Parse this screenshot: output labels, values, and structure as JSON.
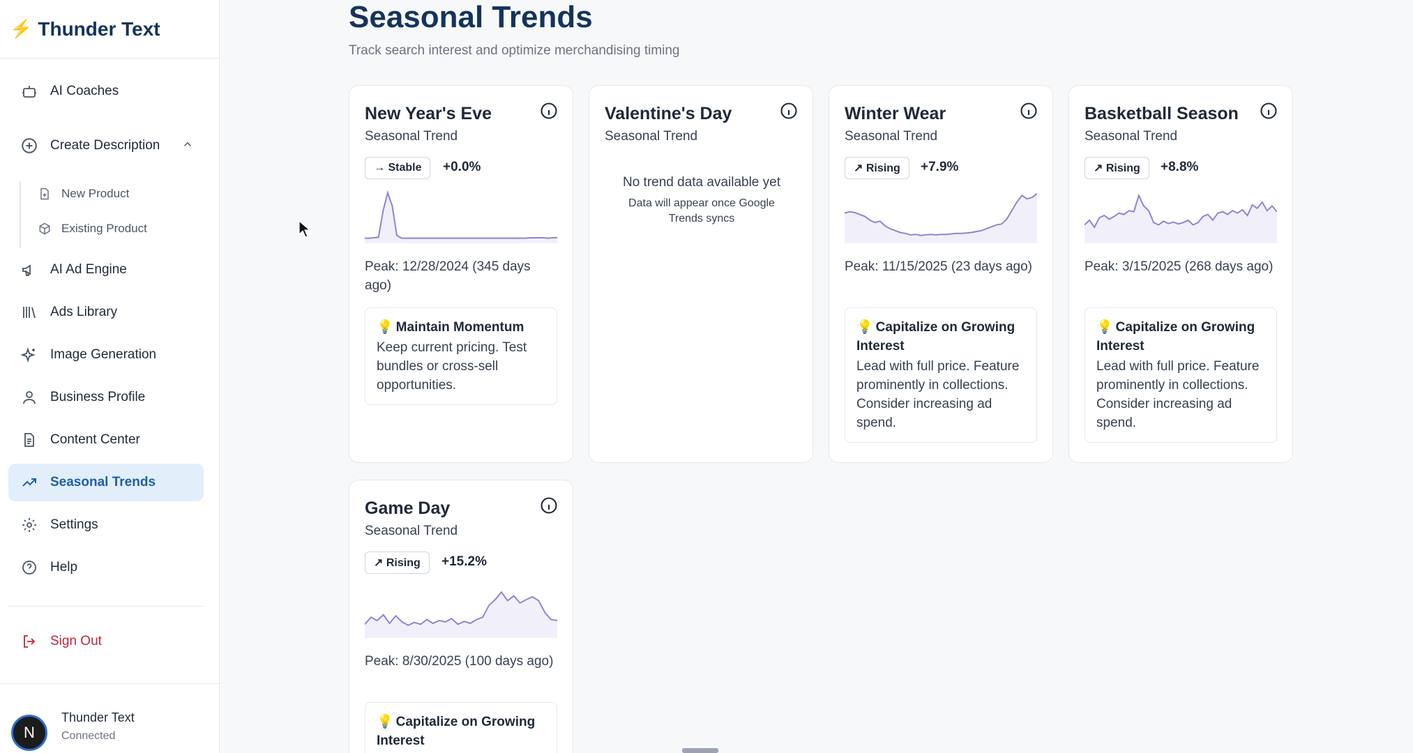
{
  "app": {
    "brand": "Thunder Text"
  },
  "sidebar": {
    "items": [
      {
        "label": "AI Coaches",
        "icon": "robot-icon"
      },
      {
        "label": "Create Description",
        "icon": "plus-circle-icon"
      },
      {
        "label": "AI Ad Engine",
        "icon": "megaphone-icon"
      },
      {
        "label": "Ads Library",
        "icon": "library-icon"
      },
      {
        "label": "Image Generation",
        "icon": "sparkles-icon"
      },
      {
        "label": "Business Profile",
        "icon": "user-icon"
      },
      {
        "label": "Content Center",
        "icon": "document-icon"
      },
      {
        "label": "Seasonal Trends",
        "icon": "trending-up-icon"
      },
      {
        "label": "Settings",
        "icon": "gear-icon"
      },
      {
        "label": "Help",
        "icon": "help-circle-icon"
      }
    ],
    "subitems": [
      {
        "label": "New Product",
        "icon": "file-plus-icon"
      },
      {
        "label": "Existing Product",
        "icon": "box-icon"
      }
    ],
    "signout": "Sign Out",
    "account": {
      "name": "Thunder Text",
      "status": "Connected",
      "initial": "N"
    }
  },
  "page": {
    "title": "Seasonal Trends",
    "subtitle": "Track search interest and optimize merchandising timing"
  },
  "cards": [
    {
      "title": "New Year's Eve",
      "subtitle": "Seasonal Trend",
      "badge": "→ Stable",
      "pct": "+0.0%",
      "peak": "Peak: 12/28/2024 (345 days ago)",
      "tip_title": "Maintain Momentum",
      "tip_body": "Keep current pricing. Test bundles or cross-sell opportunities."
    },
    {
      "title": "Valentine's Day",
      "subtitle": "Seasonal Trend",
      "nodata_title": "No trend data available yet",
      "nodata_body": "Data will appear once Google Trends syncs"
    },
    {
      "title": "Winter Wear",
      "subtitle": "Seasonal Trend",
      "badge": "↗ Rising",
      "pct": "+7.9%",
      "peak": "Peak: 11/15/2025 (23 days ago)",
      "tip_title": "Capitalize on Growing Interest",
      "tip_body": "Lead with full price. Feature prominently in collections. Consider increasing ad spend."
    },
    {
      "title": "Basketball Season",
      "subtitle": "Seasonal Trend",
      "badge": "↗ Rising",
      "pct": "+8.8%",
      "peak": "Peak: 3/15/2025 (268 days ago)",
      "tip_title": "Capitalize on Growing Interest",
      "tip_body": "Lead with full price. Feature prominently in collections. Consider increasing ad spend."
    },
    {
      "title": "Game Day",
      "subtitle": "Seasonal Trend",
      "badge": "↗ Rising",
      "pct": "+15.2%",
      "peak": "Peak: 8/30/2025 (100 days ago)",
      "tip_title": "Capitalize on Growing Interest",
      "tip_body": ""
    }
  ],
  "sparklines": {
    "new_years_eve": [
      2,
      2,
      3,
      4,
      60,
      98,
      70,
      8,
      2,
      2,
      2,
      2,
      2,
      2,
      2,
      2,
      2,
      2,
      2,
      2,
      2,
      2,
      2,
      2,
      2,
      2,
      2,
      2,
      2,
      2,
      2,
      2,
      2,
      2,
      2,
      2,
      3,
      3,
      3,
      3,
      2,
      3,
      3
    ],
    "winter_wear": [
      55,
      58,
      56,
      52,
      48,
      40,
      35,
      38,
      28,
      22,
      18,
      14,
      12,
      9,
      10,
      8,
      9,
      10,
      9,
      10,
      10,
      11,
      12,
      12,
      13,
      14,
      16,
      18,
      22,
      26,
      30,
      32,
      42,
      60,
      78,
      92,
      85,
      88,
      96
    ],
    "basketball_season": [
      30,
      40,
      25,
      45,
      50,
      42,
      48,
      55,
      52,
      60,
      58,
      92,
      70,
      60,
      35,
      30,
      38,
      33,
      36,
      32,
      35,
      40,
      30,
      35,
      48,
      52,
      40,
      55,
      58,
      52,
      60,
      55,
      62,
      50,
      72,
      65,
      78,
      60,
      70,
      58
    ],
    "game_day": [
      20,
      35,
      28,
      40,
      22,
      38,
      25,
      18,
      24,
      20,
      30,
      22,
      28,
      25,
      32,
      20,
      26,
      22,
      30,
      35,
      60,
      72,
      88,
      70,
      80,
      65,
      72,
      78,
      70,
      45,
      30,
      28
    ]
  },
  "colors": {
    "accent": "#1d5fa8",
    "spark": "#8b85d6",
    "brand": "#15345b",
    "danger": "#c0263b"
  }
}
